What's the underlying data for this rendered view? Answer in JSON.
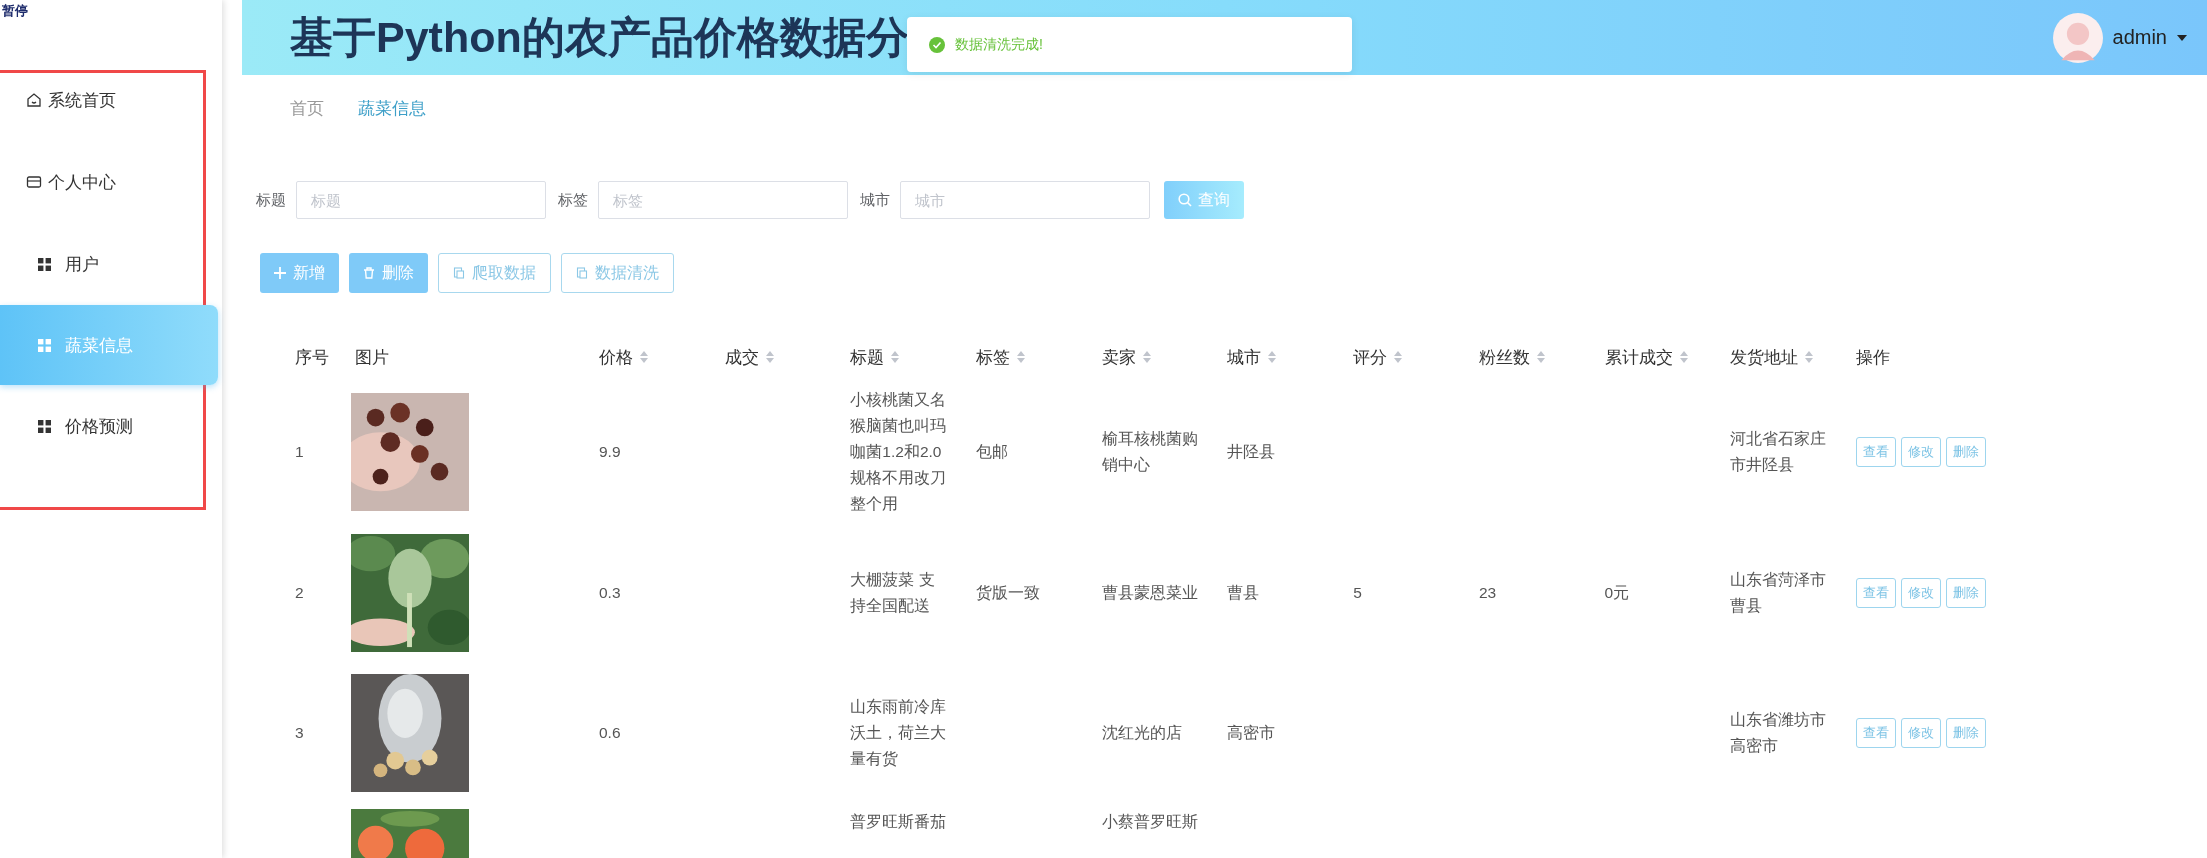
{
  "overlay_label": "暂停",
  "header": {
    "title": "基于Python的农产品价格数据分",
    "user": "admin"
  },
  "toast": {
    "message": "数据清洗完成!"
  },
  "sidebar": {
    "items": [
      {
        "label": "系统首页",
        "kind": "home",
        "selected": false
      },
      {
        "label": "个人中心",
        "kind": "card",
        "selected": false
      },
      {
        "label": "用户",
        "kind": "grid",
        "selected": false
      },
      {
        "label": "蔬菜信息",
        "kind": "grid",
        "selected": true
      },
      {
        "label": "价格预测",
        "kind": "grid",
        "selected": false
      }
    ]
  },
  "breadcrumb": [
    {
      "label": "首页",
      "selected": false
    },
    {
      "label": "蔬菜信息",
      "selected": true
    }
  ],
  "search": {
    "fields": [
      {
        "label": "标题",
        "placeholder": "标题"
      },
      {
        "label": "标签",
        "placeholder": "标签"
      },
      {
        "label": "城市",
        "placeholder": "城市"
      }
    ],
    "button": "查询"
  },
  "actions": [
    {
      "label": "新增",
      "kind": "add"
    },
    {
      "label": "删除",
      "kind": "delete"
    },
    {
      "label": "爬取数据",
      "kind": "plain"
    },
    {
      "label": "数据清洗",
      "kind": "plain"
    }
  ],
  "table": {
    "columns": [
      {
        "label": "序号",
        "sortable": false
      },
      {
        "label": "图片",
        "sortable": false
      },
      {
        "label": "价格",
        "sortable": true
      },
      {
        "label": "成交",
        "sortable": true
      },
      {
        "label": "标题",
        "sortable": true
      },
      {
        "label": "标签",
        "sortable": true
      },
      {
        "label": "卖家",
        "sortable": true
      },
      {
        "label": "城市",
        "sortable": true
      },
      {
        "label": "评分",
        "sortable": true
      },
      {
        "label": "粉丝数",
        "sortable": true
      },
      {
        "label": "累计成交",
        "sortable": true
      },
      {
        "label": "发货地址",
        "sortable": true
      },
      {
        "label": "操作",
        "sortable": false
      }
    ],
    "rows": [
      {
        "index": "1",
        "picture": {
          "kind": "picture"
        },
        "price": "9.9",
        "title": "小核桃菌又名猴脑菌也叫玛咖菌1.2和2.0规格不用改刀整个用",
        "tag": "包邮",
        "seller": "榆耳核桃菌购销中心",
        "city": "井陉县",
        "address": "河北省石家庄市井陉县",
        "actions": [
          "查看",
          "修改",
          "删除"
        ]
      },
      {
        "index": "2",
        "picture": {
          "kind": "picture"
        },
        "price": "0.3",
        "title": "大棚菠菜 支持全国配送",
        "tag": "货版一致",
        "seller": "曹县蒙恩菜业",
        "city": "曹县",
        "rating": "5",
        "fans": "23",
        "total": "0元",
        "address": "山东省菏泽市曹县",
        "actions": [
          "查看",
          "修改",
          "删除"
        ]
      },
      {
        "index": "3",
        "picture": {
          "kind": "picture"
        },
        "price": "0.6",
        "title": "山东雨前冷库沃土，荷兰大量有货",
        "seller": "沈红光的店",
        "city": "高密市",
        "address": "山东省潍坊市高密市",
        "actions": [
          "查看",
          "修改",
          "删除"
        ]
      },
      {
        "picture": {
          "kind": "picture"
        },
        "title": "普罗旺斯番茄",
        "seller": "小蔡普罗旺斯"
      }
    ]
  }
}
